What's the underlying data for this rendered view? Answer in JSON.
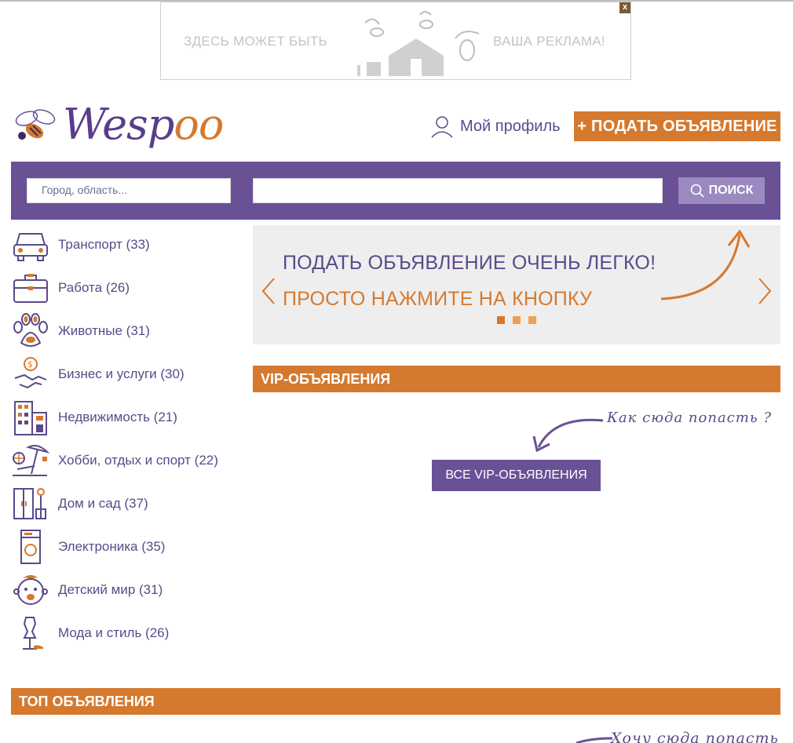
{
  "ad": {
    "left_text": "ЗДЕСЬ МОЖЕТ БЫТЬ",
    "right_text": "ВАША РЕКЛАМА!",
    "close": "x"
  },
  "header": {
    "logo_prefix": "Wesp",
    "logo_oo": "oo",
    "profile_label": "Мой профиль",
    "post_button": "+ ПОДАТЬ ОБЪЯВЛЕНИЕ"
  },
  "search": {
    "city_placeholder": "Город, область...",
    "button_label": "ПОИСК"
  },
  "categories": [
    {
      "label": "Транспорт (33)",
      "icon": "car-icon"
    },
    {
      "label": "Работа (26)",
      "icon": "briefcase-icon"
    },
    {
      "label": "Животные (31)",
      "icon": "paw-icon"
    },
    {
      "label": "Бизнес и услуги (30)",
      "icon": "handshake-icon"
    },
    {
      "label": "Недвижимость (21)",
      "icon": "building-icon"
    },
    {
      "label": "Хобби, отдых и спорт (22)",
      "icon": "beach-icon"
    },
    {
      "label": "Дом и сад (37)",
      "icon": "furniture-icon"
    },
    {
      "label": "Электроника (35)",
      "icon": "washing-machine-icon"
    },
    {
      "label": "Детский мир (31)",
      "icon": "baby-icon"
    },
    {
      "label": "Мода и стиль (26)",
      "icon": "mannequin-icon"
    }
  ],
  "slider": {
    "line1": "ПОДАТЬ ОБЪЯВЛЕНИЕ ОЧЕНЬ ЛЕГКО!",
    "line2": "ПРОСТО НАЖМИТЕ НА КНОПКУ"
  },
  "vip": {
    "heading": "VIP-ОБЪЯВЛЕНИЯ",
    "how_text": "Как сюда попасть ?",
    "all_button": "ВСЕ VIP-ОБЪЯВЛЕНИЯ"
  },
  "top": {
    "heading": "ТОП ОБЪЯВЛЕНИЯ",
    "how_text": "Хочу сюда попасть"
  },
  "colors": {
    "purple": "#6a5196",
    "orange": "#d5792e"
  }
}
